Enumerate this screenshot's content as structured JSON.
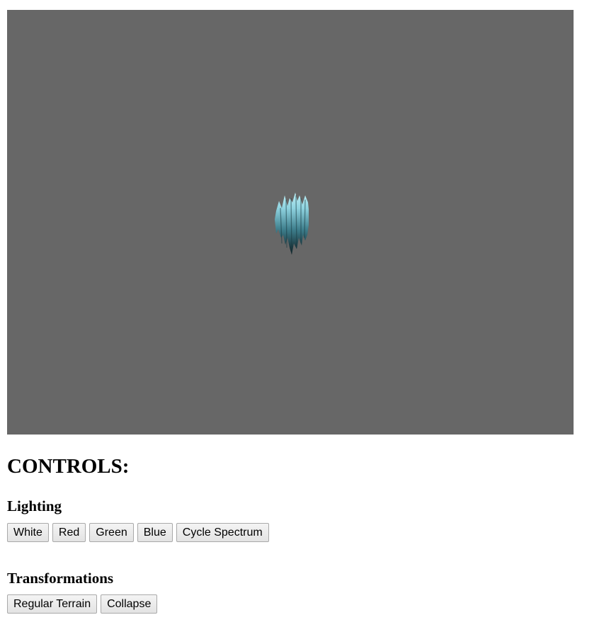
{
  "controls": {
    "title": "CONTROLS:"
  },
  "lighting": {
    "title": "Lighting",
    "buttons": {
      "white": "White",
      "red": "Red",
      "green": "Green",
      "blue": "Blue",
      "cycle": "Cycle Spectrum"
    }
  },
  "transformations": {
    "title": "Transformations",
    "buttons": {
      "regular_terrain": "Regular Terrain",
      "collapse": "Collapse"
    }
  },
  "colors": {
    "canvas_background": "#676767",
    "terrain_light": "#9fe2ee",
    "terrain_dark": "#0d1a1e"
  }
}
